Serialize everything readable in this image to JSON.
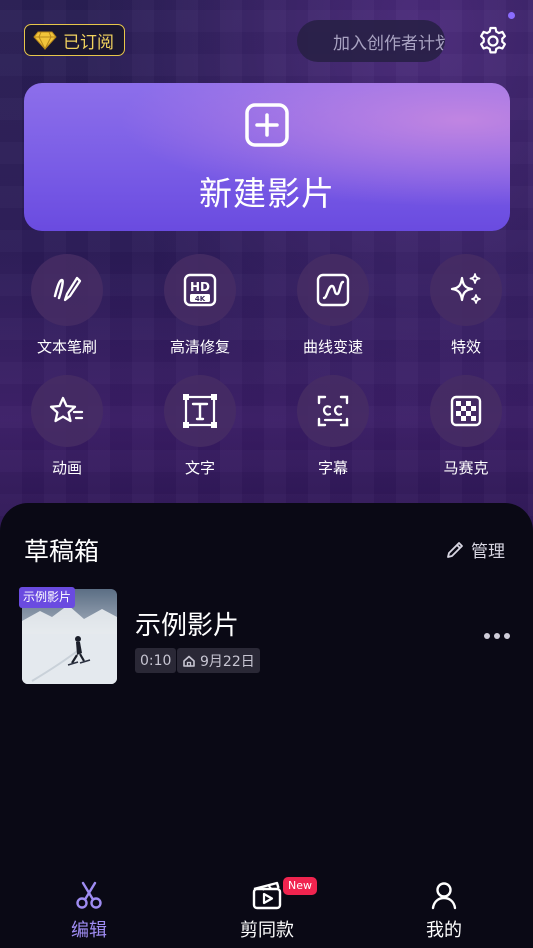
{
  "header": {
    "subscription_label": "已订阅",
    "join_label": "加入创作者计划"
  },
  "new_project": {
    "label": "新建影片"
  },
  "tools": [
    {
      "label": "文本笔刷",
      "icon": "text-brush-icon"
    },
    {
      "label": "高清修复",
      "icon": "hd-4k-icon"
    },
    {
      "label": "曲线变速",
      "icon": "curve-speed-icon"
    },
    {
      "label": "特效",
      "icon": "sparkle-effects-icon"
    },
    {
      "label": "动画",
      "icon": "star-animation-icon"
    },
    {
      "label": "文字",
      "icon": "text-frame-icon"
    },
    {
      "label": "字幕",
      "icon": "caption-cc-icon"
    },
    {
      "label": "马赛克",
      "icon": "mosaic-icon"
    }
  ],
  "drafts": {
    "title": "草稿箱",
    "manage_label": "管理",
    "items": [
      {
        "tag": "示例影片",
        "name": "示例影片",
        "duration": "0:10",
        "date": "9月22日"
      }
    ]
  },
  "nav": {
    "items": [
      {
        "label": "编辑",
        "icon": "scissors-icon",
        "active": true
      },
      {
        "label": "剪同款",
        "icon": "template-clapper-icon",
        "badge": "New"
      },
      {
        "label": "我的",
        "icon": "profile-icon"
      }
    ]
  },
  "colors": {
    "accent": "#7a5de6",
    "gold": "#e7c64a",
    "badge_red": "#f0244f",
    "active_nav": "#9f8cf2"
  }
}
